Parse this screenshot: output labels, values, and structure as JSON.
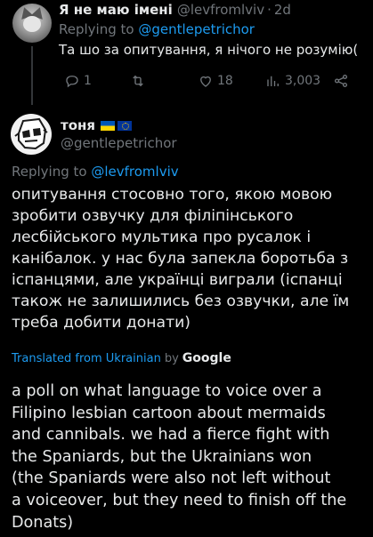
{
  "reply": {
    "display_name": "Я не маю імені",
    "handle": "@levfromlviv",
    "separator": "·",
    "time": "2d",
    "replying_prefix": "Replying to",
    "replying_handle": "@gentlepetrichor",
    "text": "Та шо за опитування, я нічого не розумію(",
    "actions": {
      "reply_count": "1",
      "retweet_count": "",
      "like_count": "18",
      "views_count": "3,003"
    }
  },
  "tweet": {
    "display_name": "тоня",
    "flags": [
      "ua-flag",
      "eu-flag"
    ],
    "handle": "@gentlepetrichor",
    "replying_prefix": "Replying to",
    "replying_handle": "@levfromlviv",
    "text": "опитування стосовно того, якою мовою\nзробити озвучку для філіпінського\nлесбійського мультика про русалок і\nканібалок. у нас була запекла боротьба з\nіспанцями, але українці виграли (іспанці\nтакож не залишились без озвучки, але їм\nтреба добити донати)",
    "translated_label": "Translated from Ukrainian",
    "translated_by": "by",
    "translator": "Google",
    "translation": "a poll on what language to voice over a\nFilipino lesbian cartoon about mermaids\nand cannibals. we had a fierce fight with\nthe Spaniards, but the Ukrainians won\n(the Spaniards were also not left without\na voiceover, but they need to finish off the\nDonats)"
  },
  "colors": {
    "background": "#000000",
    "text": "#e7e9ea",
    "secondary": "#71767b",
    "link": "#1d9bf0"
  }
}
